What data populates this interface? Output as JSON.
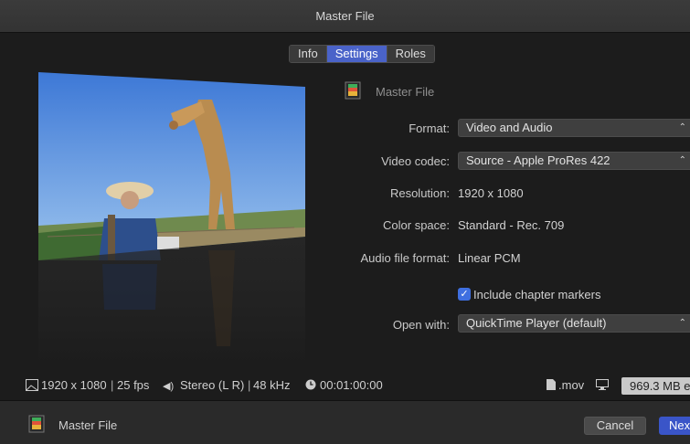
{
  "window": {
    "title": "Master File"
  },
  "tabs": [
    {
      "label": "Info",
      "active": false
    },
    {
      "label": "Settings",
      "active": true
    },
    {
      "label": "Roles",
      "active": false
    }
  ],
  "settings": {
    "file_title": "Master File",
    "format": {
      "label": "Format:",
      "value": "Video and Audio"
    },
    "video_codec": {
      "label": "Video codec:",
      "value": "Source - Apple ProRes 422"
    },
    "resolution": {
      "label": "Resolution:",
      "value": "1920 x 1080"
    },
    "color_space": {
      "label": "Color space:",
      "value": "Standard - Rec. 709"
    },
    "audio_format": {
      "label": "Audio file format:",
      "value": "Linear PCM"
    },
    "chapter_markers": {
      "label": "Include chapter markers",
      "checked": true
    },
    "open_with": {
      "label": "Open with:",
      "value": "QuickTime Player (default)"
    }
  },
  "info_bar": {
    "video": "1920 x 1080",
    "fps": "25 fps",
    "audio": "Stereo (L R)",
    "sample_rate": "48 kHz",
    "duration": "00:01:00:00",
    "extension": ".mov",
    "size": "969.3 MB e"
  },
  "footer": {
    "title": "Master File",
    "cancel_label": "Cancel",
    "next_label": "Nex"
  },
  "colors": {
    "accent": "#4a63c9",
    "primary_button": "#3a55c8",
    "checkbox": "#3f6fe0"
  }
}
